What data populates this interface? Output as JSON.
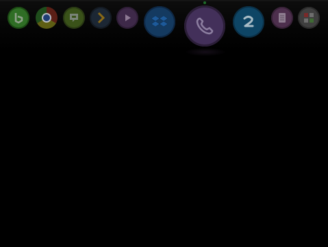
{
  "dock": {
    "apps": [
      {
        "id": "bing",
        "icon": "bing-b-icon",
        "color": "#3f8a2e",
        "ring": "#1c4a14"
      },
      {
        "id": "chrome",
        "icon": "chrome-icon",
        "color": "#6b6b18",
        "ring": "#3b1f17"
      },
      {
        "id": "hangouts",
        "icon": "chat-bubble-icon",
        "color": "#3f5a1c",
        "ring": "#2a3a14"
      },
      {
        "id": "plex",
        "icon": "chevron-right-icon",
        "color": "#1f2a38",
        "ring": "#141a22"
      },
      {
        "id": "play",
        "icon": "play-icon",
        "color": "#4a2f55",
        "ring": "#2f1e37"
      },
      {
        "id": "dropbox",
        "icon": "dropbox-icon",
        "color": "#153b62",
        "ring": "#0e2744"
      },
      {
        "id": "phone",
        "icon": "phone-handset-icon",
        "color": "#46305a",
        "ring": "#2b1e38"
      },
      {
        "id": "z-app",
        "icon": "z-letter-icon",
        "color": "#0f4766",
        "ring": "#0b3047"
      },
      {
        "id": "notes",
        "icon": "notepad-icon",
        "color": "#553354",
        "ring": "#382238"
      },
      {
        "id": "gallery",
        "icon": "gallery-icon",
        "color": "#4b4b4b",
        "ring": "#2c2c2c"
      }
    ]
  }
}
